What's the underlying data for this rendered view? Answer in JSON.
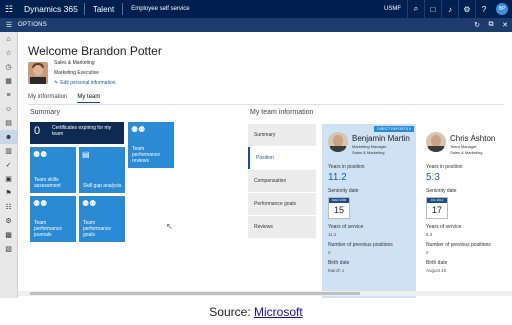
{
  "topbar": {
    "brand": "Dynamics 365",
    "module": "Talent",
    "breadcrumb": "Employee self service",
    "company": "USMF",
    "icons": [
      "search-icon",
      "chat-icon",
      "bell-icon",
      "gear-icon",
      "help-icon"
    ],
    "user_initials": "BP"
  },
  "optbar": {
    "label": "OPTIONS"
  },
  "page": {
    "welcome": "Welcome Brandon Potter",
    "department": "Sales & Marketing",
    "title": "Marketing Executive",
    "edit_link": "Edit personal information",
    "tabs": [
      "My information",
      "My team"
    ],
    "active_tab": "My team"
  },
  "summary": {
    "title": "Summary",
    "cert_count": "0",
    "cert_text": "Certificates expiring for my team",
    "tiles": [
      "Team performance reviews",
      "Team skills assessment",
      "Skill gap analysis",
      "Team performance journals",
      "Team performance goals"
    ]
  },
  "team": {
    "title": "My team information",
    "menu": [
      "Summary",
      "Position",
      "Compensation",
      "Performance goals",
      "Reviews"
    ],
    "active_menu": "Position",
    "members": [
      {
        "badge": "DIRECT REPORTS 5",
        "name": "Benjamin Martin",
        "role": "Marketing Manager",
        "dept": "Sales & Marketing",
        "years_label": "Years in position",
        "years": "11.2",
        "seniority_label": "Seniority date",
        "cal_month": "MAR 2006",
        "cal_day": "15",
        "service_label": "Years of service",
        "service": "11.2",
        "prev_label": "Number of previous positions",
        "prev": "0",
        "birth_label": "Birth date",
        "birth": "March 1"
      },
      {
        "name": "Chris Ashton",
        "role": "Team Manager",
        "dept": "Sales & Marketing",
        "years_label": "Years in position",
        "years": "5.3",
        "seniority_label": "Seniority date",
        "cal_month": "JUL 2012",
        "cal_day": "17",
        "service_label": "Years of service",
        "service": "5.3",
        "prev_label": "Number of previous positions",
        "prev": "0",
        "birth_label": "Birth date",
        "birth": "August 10"
      }
    ]
  },
  "caption": {
    "prefix": "Source: ",
    "link": "Microsoft"
  },
  "colors": {
    "nav": "#002050",
    "tile": "#2a8ad4",
    "selected_card": "#cfe2f3"
  }
}
